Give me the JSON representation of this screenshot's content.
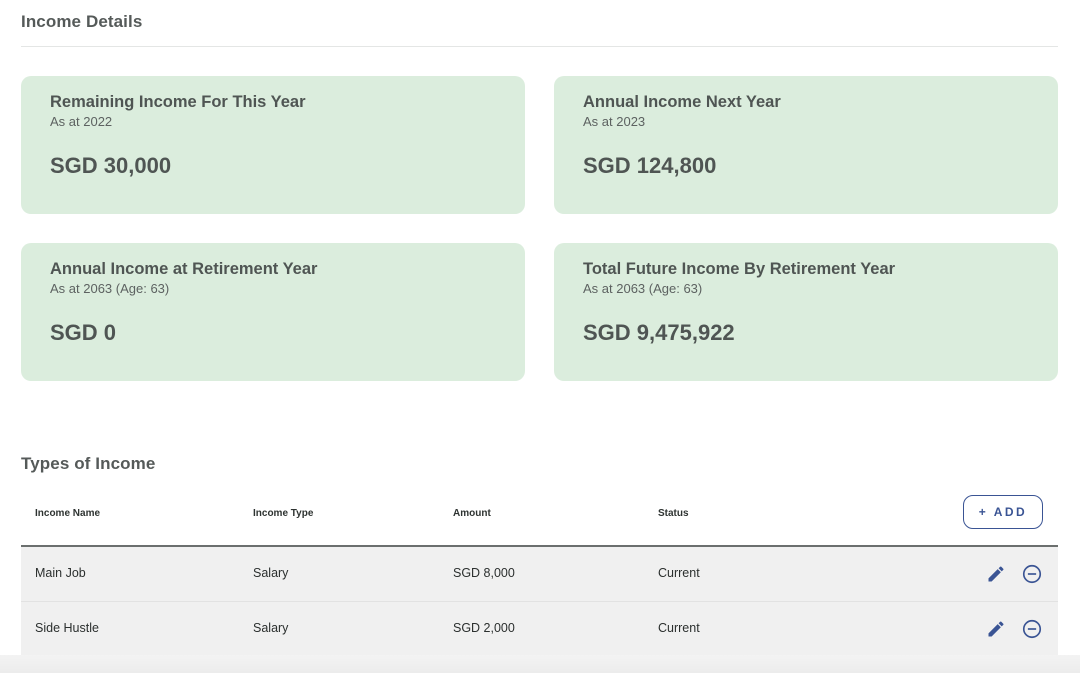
{
  "income_details": {
    "title": "Income Details",
    "cards": [
      {
        "title": "Remaining Income For This Year",
        "subtitle": "As at 2022",
        "value": "SGD 30,000"
      },
      {
        "title": "Annual Income Next Year",
        "subtitle": "As at 2023",
        "value": "SGD 124,800"
      },
      {
        "title": "Annual Income at Retirement Year",
        "subtitle": "As at 2063 (Age: 63)",
        "value": "SGD 0"
      },
      {
        "title": "Total Future Income By Retirement Year",
        "subtitle": "As at 2063 (Age: 63)",
        "value": "SGD 9,475,922"
      }
    ]
  },
  "types_of_income": {
    "title": "Types of Income",
    "add_label": "+ ADD",
    "columns": [
      "Income Name",
      "Income Type",
      "Amount",
      "Status"
    ],
    "rows": [
      {
        "name": "Main Job",
        "type": "Salary",
        "amount": "SGD 8,000",
        "status": "Current"
      },
      {
        "name": "Side Hustle",
        "type": "Salary",
        "amount": "SGD 2,000",
        "status": "Current"
      }
    ],
    "row_actions": {
      "edit_icon": "pencil-icon",
      "remove_icon": "minus-circle-icon"
    }
  },
  "colors": {
    "card_background": "#dbeddd",
    "accent": "#3a5494",
    "text": "#4f5553"
  }
}
